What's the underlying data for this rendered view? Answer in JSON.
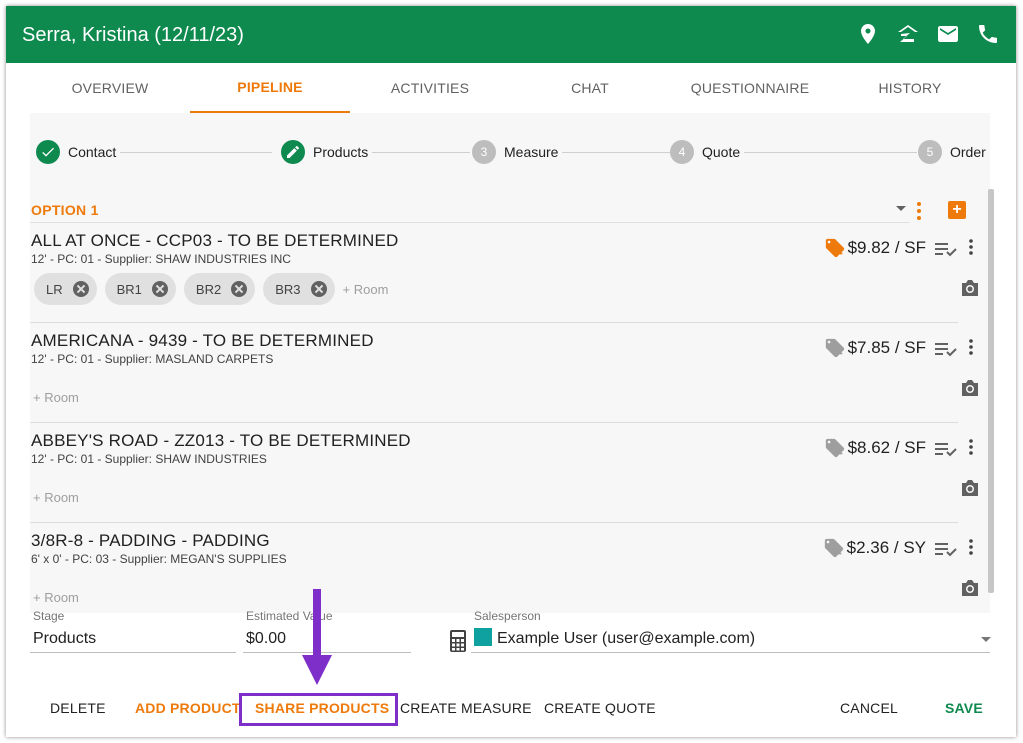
{
  "header": {
    "title": "Serra, Kristina (12/11/23)",
    "icons": [
      "location-pin-icon",
      "zillow-icon",
      "email-icon",
      "phone-icon"
    ]
  },
  "tabs": [
    {
      "label": "OVERVIEW",
      "active": false
    },
    {
      "label": "PIPELINE",
      "active": true
    },
    {
      "label": "ACTIVITIES",
      "active": false
    },
    {
      "label": "CHAT",
      "active": false
    },
    {
      "label": "QUESTIONNAIRE",
      "active": false
    },
    {
      "label": "HISTORY",
      "active": false
    }
  ],
  "stepper": [
    {
      "label": "Contact",
      "state": "done",
      "marker": "check-icon"
    },
    {
      "label": "Products",
      "state": "current",
      "marker": "pencil-icon"
    },
    {
      "label": "Measure",
      "state": "todo",
      "marker": "3"
    },
    {
      "label": "Quote",
      "state": "todo",
      "marker": "4"
    },
    {
      "label": "Order",
      "state": "todo",
      "marker": "5"
    }
  ],
  "option": {
    "label": "OPTION 1"
  },
  "add_room_label": "+ Room",
  "products": [
    {
      "name": "ALL AT ONCE - CCP03 - TO BE DETERMINED",
      "details": "12' - PC: 01 - Supplier: SHAW INDUSTRIES INC",
      "price": "$9.82 / SF",
      "tag_color": "#ee7a0c",
      "rooms": [
        "LR",
        "BR1",
        "BR2",
        "BR3"
      ]
    },
    {
      "name": "AMERICANA - 9439 - TO BE DETERMINED",
      "details": "12' - PC: 01 - Supplier: MASLAND CARPETS",
      "price": "$7.85 / SF",
      "tag_color": "#9e9e9e",
      "rooms": []
    },
    {
      "name": "ABBEY'S ROAD - ZZ013 - TO BE DETERMINED",
      "details": "12' - PC: 01 - Supplier: SHAW INDUSTRIES",
      "price": "$8.62 / SF",
      "tag_color": "#9e9e9e",
      "rooms": []
    },
    {
      "name": "3/8R-8 - PADDING - PADDING",
      "details": "6' x 0' - PC: 03 - Supplier: MEGAN'S SUPPLIES",
      "price": "$2.36 / SY",
      "tag_color": "#9e9e9e",
      "rooms": []
    }
  ],
  "fields": {
    "stage": {
      "label": "Stage",
      "value": "Products"
    },
    "estimated_value": {
      "label": "Estimated Value",
      "value": "$0.00"
    },
    "salesperson": {
      "label": "Salesperson",
      "value": "Example User (user@example.com)",
      "swatch_color": "#0fa0a0"
    }
  },
  "actions": {
    "delete": "DELETE",
    "add_product": "ADD PRODUCT",
    "share_products": "SHARE PRODUCTS",
    "create_measure": "CREATE MEASURE",
    "create_quote": "CREATE QUOTE",
    "cancel": "CANCEL",
    "save": "SAVE"
  },
  "colors": {
    "brand_green": "#0e8a4f",
    "accent_orange": "#ee7a0c",
    "annotation_purple": "#7f2fc9"
  }
}
